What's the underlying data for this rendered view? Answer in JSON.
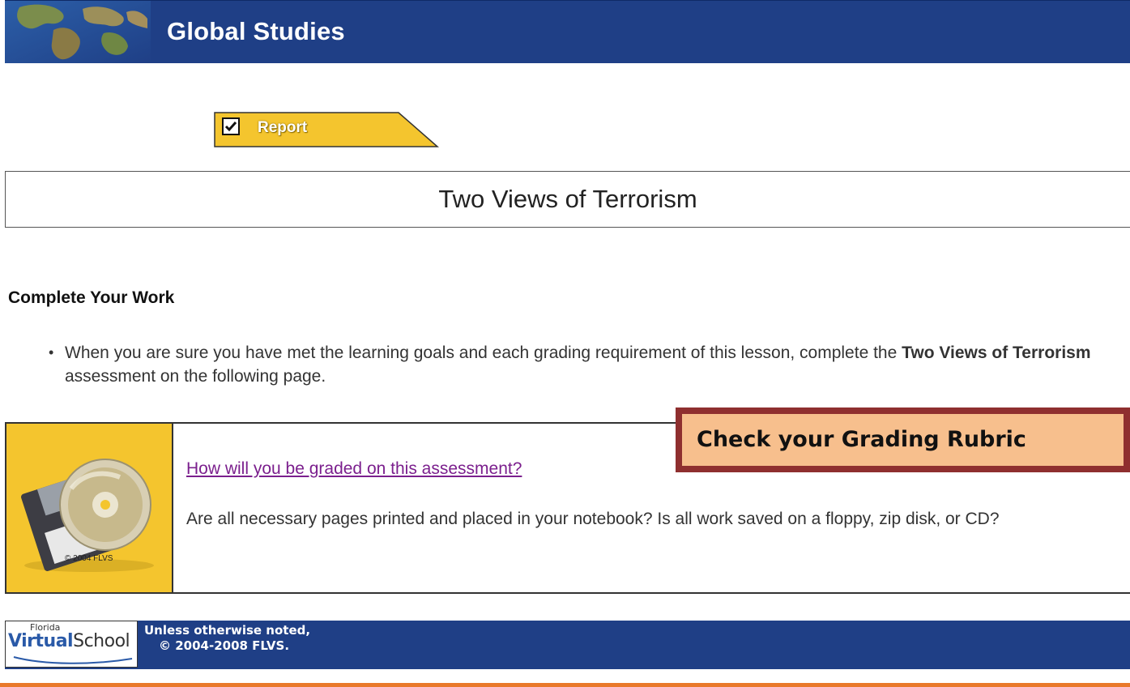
{
  "header": {
    "title": "Global Studies"
  },
  "report_tab": {
    "label": "Report",
    "checked": true
  },
  "page_title": "Two Views of Terrorism",
  "section": {
    "heading": "Complete Your Work",
    "bullet": {
      "pre": "When you are sure you have met the learning goals and each grading requirement of this lesson, complete the ",
      "bold": "Two Views of Terrorism",
      "post": " assessment on the following page."
    }
  },
  "info_box": {
    "image_copyright": "© 2004 FLVS",
    "link": "How will you be graded on this assessment?",
    "text": "Are all necessary pages printed and placed in your notebook? Is all work saved on a floppy, zip disk, or CD?"
  },
  "callout": {
    "text": "Check your Grading Rubric"
  },
  "footer": {
    "logo_state": "Florida",
    "logo_virtual": "Virtual",
    "logo_school": "School",
    "line1": "Unless otherwise noted,",
    "line2": "© 2004-2008 FLVS."
  },
  "colors": {
    "header_blue": "#1f3f86",
    "tab_yellow": "#f4c52e",
    "callout_fill": "#f7bf8d",
    "callout_border": "#8f2f2f",
    "link_purple": "#7b1f8d",
    "bottom_rule": "#e9792a"
  }
}
